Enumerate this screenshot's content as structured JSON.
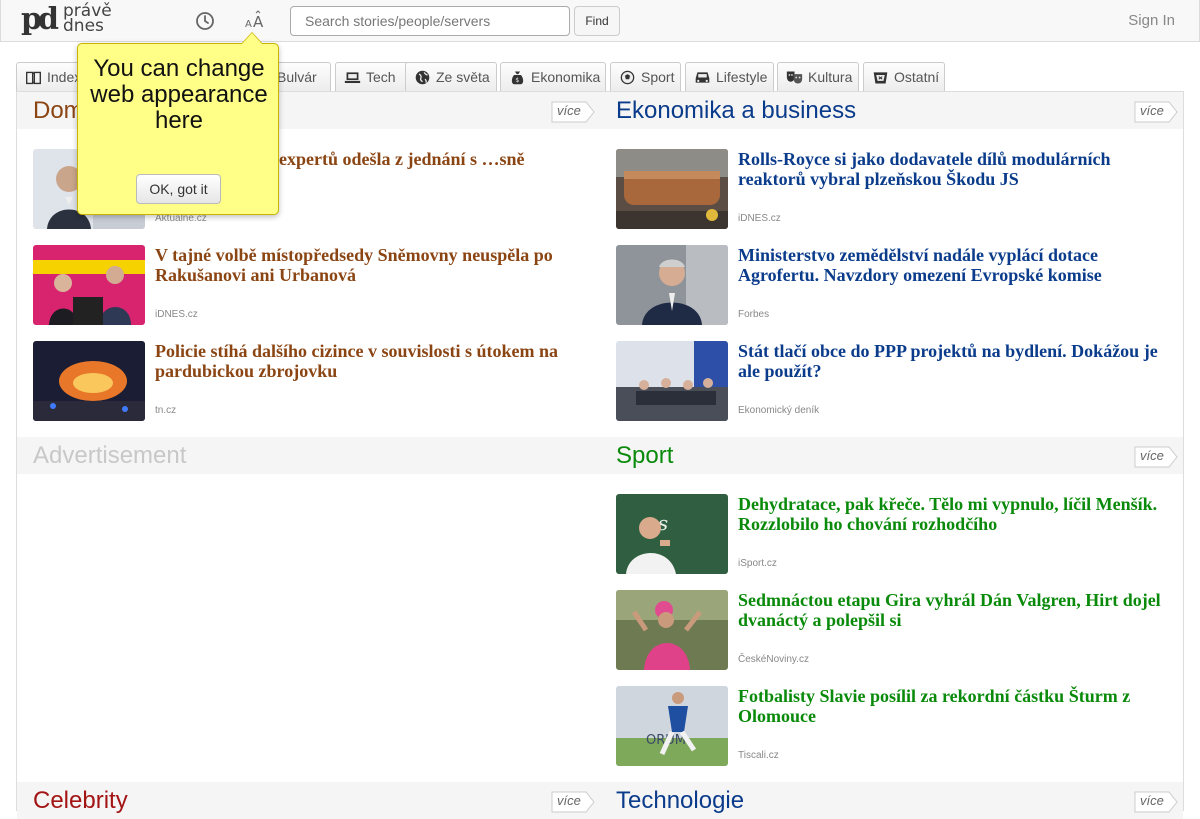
{
  "logo": {
    "mark": "pd",
    "line1": "právě",
    "line2": "dnes"
  },
  "navbar": {
    "search_placeholder": "Search stories/people/servers",
    "find_label": "Find",
    "sign_in_label": "Sign In"
  },
  "tabs": [
    {
      "label": "Index",
      "icon": "book-icon"
    },
    {
      "label": "Bulvár",
      "icon": "newspaper-icon"
    },
    {
      "label": "Tech",
      "icon": "laptop-icon"
    },
    {
      "label": "Ze světa",
      "icon": "globe-icon"
    },
    {
      "label": "Ekonomika",
      "icon": "money-bag-icon"
    },
    {
      "label": "Sport",
      "icon": "soccer-ball-icon"
    },
    {
      "label": "Lifestyle",
      "icon": "car-icon"
    },
    {
      "label": "Kultura",
      "icon": "theater-masks-icon"
    },
    {
      "label": "Ostatní",
      "icon": "bucket-icon"
    }
  ],
  "tooltip": {
    "text": "You can change web appearance here",
    "button_label": "OK, got it"
  },
  "sections": {
    "domov": {
      "title": "Domov",
      "more_label": "více",
      "items": [
        {
          "headline": "…akovce? Část expertů odešla z jednání s …sně",
          "source": "Aktuálně.cz"
        },
        {
          "headline": "V tajné volbě místopředsedy Sněmovny neuspěla po Rakušanovi ani Urbanová",
          "source": "iDNES.cz"
        },
        {
          "headline": "Policie stíhá dalšího cizince v souvislosti s útokem na pardubickou zbrojovku",
          "source": "tn.cz"
        }
      ]
    },
    "ekonomika": {
      "title": "Ekonomika a business",
      "more_label": "více",
      "items": [
        {
          "headline": "Rolls-Royce si jako dodavatele dílů modulárních reaktorů vybral plzeňskou Škodu JS",
          "source": "iDNES.cz"
        },
        {
          "headline": "Ministerstvo zemědělství nadále vyplácí dotace Agrofertu. Navzdory omezení Evropské komise",
          "source": "Forbes"
        },
        {
          "headline": "Stát tlačí obce do PPP projektů na bydlení. Dokážou je ale použít?",
          "source": "Ekonomický deník"
        }
      ]
    },
    "advertisement": {
      "title": "Advertisement"
    },
    "sport": {
      "title": "Sport",
      "more_label": "více",
      "items": [
        {
          "headline": "Dehydratace, pak křeče. Tělo mi vypnulo, líčil Menšík. Rozzlobilo ho chování rozhodčího",
          "source": "iSport.cz"
        },
        {
          "headline": "Sedmnáctou etapu Gira vyhrál Dán Valgren, Hirt dojel dvanáctý a polepšil si",
          "source": "ČeskéNoviny.cz"
        },
        {
          "headline": "Fotbalisty Slavie posílil za rekordní částku Šturm z Olomouce",
          "source": "Tiscali.cz"
        }
      ]
    },
    "celebrity": {
      "title": "Celebrity",
      "more_label": "více"
    },
    "technologie": {
      "title": "Technologie",
      "more_label": "více"
    }
  },
  "colors": {
    "domov": "#8b4513",
    "ekonomika": "#0b3c8c",
    "sport": "#0a8a0a",
    "celebrity": "#a31515",
    "tooltip_bg": "#ffff88"
  }
}
